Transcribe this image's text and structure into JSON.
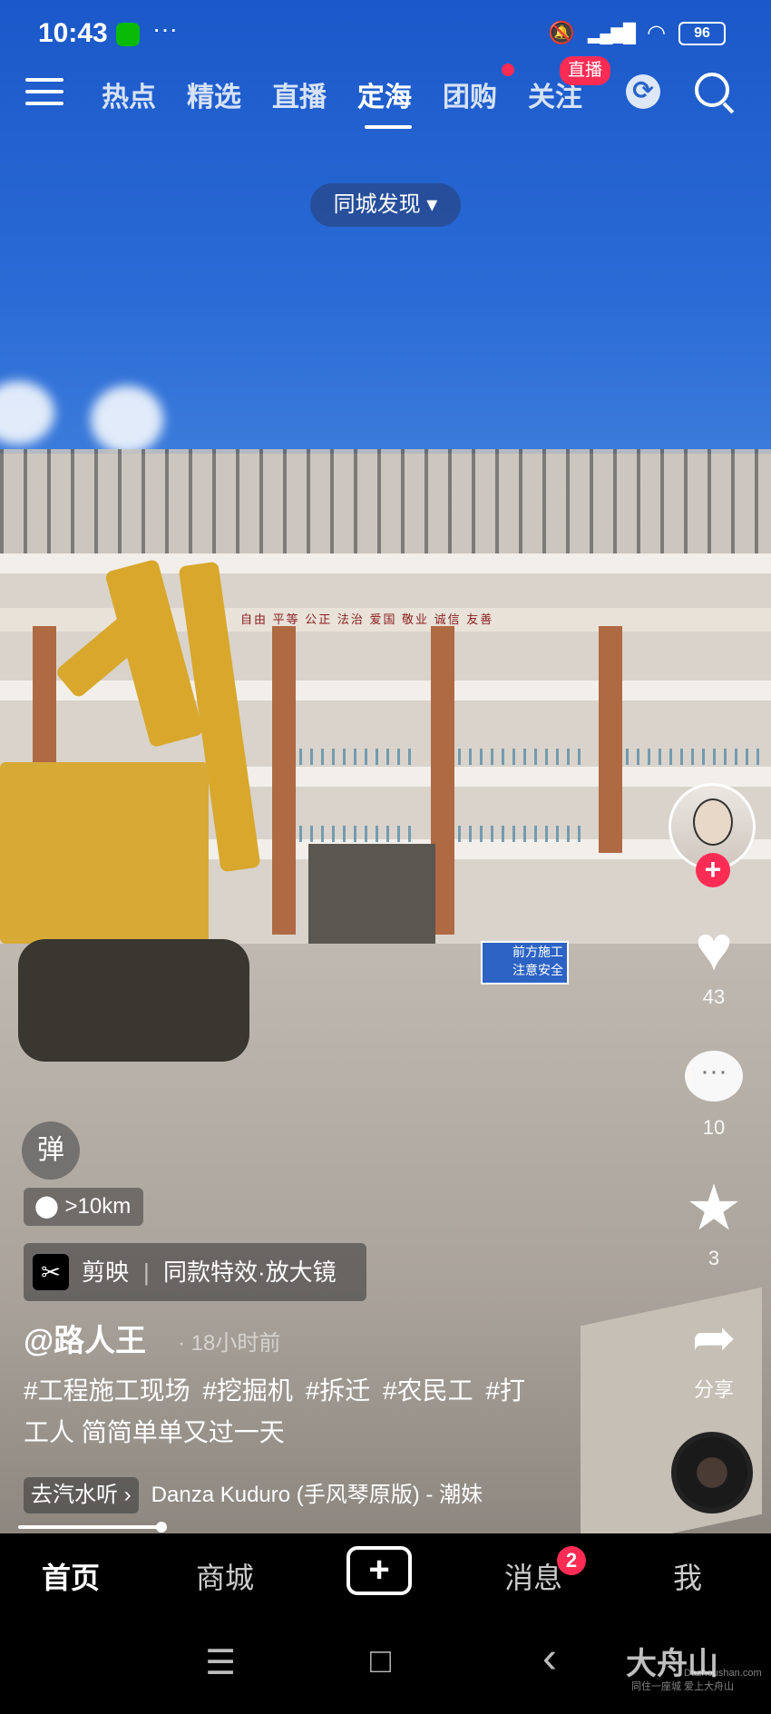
{
  "status_bar": {
    "time": "10:43",
    "dots": "···",
    "battery": "96",
    "icons": [
      "wechat-icon",
      "mute-icon",
      "signal-icon",
      "wifi-icon",
      "battery-icon"
    ]
  },
  "top_nav": {
    "tabs": [
      {
        "label": "热点",
        "active": false
      },
      {
        "label": "精选",
        "active": false
      },
      {
        "label": "直播",
        "active": false
      },
      {
        "label": "定海",
        "active": true
      },
      {
        "label": "团购",
        "active": false,
        "dot": true
      },
      {
        "label": "关注",
        "active": false
      }
    ],
    "live_badge": "直播",
    "discover_label": "同城发现 ▾"
  },
  "video": {
    "danmu_label": "弹",
    "distance": ">10km",
    "capcut_app": "剪映",
    "capcut_effect": "同款特效·放大镜",
    "author": "@路人王",
    "time_ago": "· 18小时前",
    "description_line1": "#工程施工现场 #挖掘机 #拆迁 #农民工 #打",
    "description_line2": "工人 简简单单又过一天",
    "go_listen": "去汽水听 ›",
    "music": "Danza Kuduro (手风琴原版) - 潮妹"
  },
  "right_rail": {
    "likes": "43",
    "comments": "10",
    "favorites": "3",
    "shares": "分享"
  },
  "bottom_nav": {
    "home": "首页",
    "mall": "商城",
    "plus": "+",
    "messages": "消息",
    "messages_badge": "2",
    "me": "我"
  },
  "system_nav": {
    "menu": "☰",
    "home": "□",
    "back": "‹"
  },
  "watermark": {
    "brand": "大舟山",
    "url": "Dazhoushan.com",
    "slogan": "同住一座城 爱上大舟山"
  },
  "scene_text": {
    "sign_line1": "前方施工",
    "sign_line2": "注意安全",
    "banner": "自由 平等 公正 法治 爱国 敬业 诚信 友善"
  },
  "colors": {
    "accent_red": "#fe2c55",
    "sky": "#1b58c9"
  }
}
